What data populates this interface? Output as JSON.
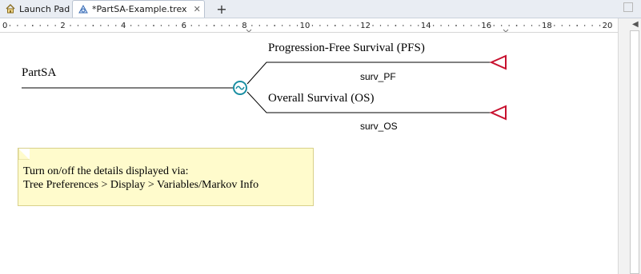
{
  "tabs": [
    {
      "label": "Launch Pad",
      "icon": "home-icon",
      "active": false
    },
    {
      "label": "*PartSA-Example.trex",
      "icon": "tree-icon",
      "active": true
    }
  ],
  "ruler": {
    "labels": [
      "0",
      "2",
      "4",
      "6",
      "8",
      "10",
      "12",
      "14",
      "16",
      "18",
      "20"
    ]
  },
  "tree": {
    "root": {
      "label": "PartSA"
    },
    "node_type": "chance-node",
    "branches": [
      {
        "name": "Progression-Free Survival (PFS)",
        "variable": "surv_PF"
      },
      {
        "name": "Overall Survival (OS)",
        "variable": "surv_OS"
      }
    ],
    "terminal_color": "#c8102e",
    "node_color": "#1b8fa3"
  },
  "note": {
    "line1": "Turn on/off the details displayed via:",
    "line2": "Tree Preferences > Display > Variables/Markov Info"
  }
}
